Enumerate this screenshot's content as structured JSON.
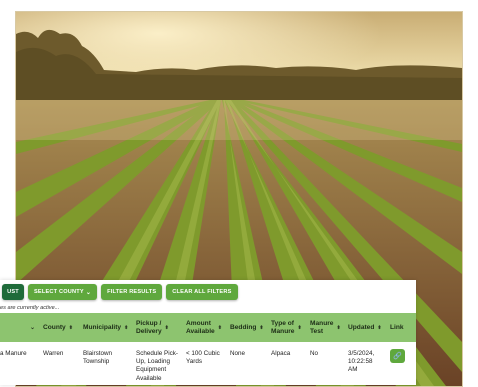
{
  "toolbar": {
    "list_label": "UST",
    "select_county_label": "SELECT COUNTY",
    "select_county_caret": "⌄",
    "filter_results_label": "FILTER RESULTS",
    "clear_filters_label": "CLEAR ALL FILTERS"
  },
  "status_text": "es are currently active...",
  "columns": {
    "county": "County",
    "municipality": "Municipality",
    "pickup_line1": "Pickup /",
    "pickup_line2": "Delivery",
    "amount_line1": "Amount",
    "amount_line2": "Available",
    "bedding": "Bedding",
    "type_line1": "Type of",
    "type_line2": "Manure",
    "test_line1": "Manure",
    "test_line2": "Test",
    "updated": "Updated",
    "link": "Link",
    "sort_glyph": "⬍",
    "first_col_caret": "⌄"
  },
  "row": {
    "name": "a Manure",
    "county": "Warren",
    "municipality_line1": "Blairstown",
    "municipality_line2": "Township",
    "pickup_line1": "Schedule Pick-",
    "pickup_line2": "Up, Loading",
    "pickup_line3": "Equipment",
    "pickup_line4": "Available",
    "amount_line1": "< 100 Cubic",
    "amount_line2": "Yards",
    "bedding": "None",
    "type": "Alpaca",
    "test": "No",
    "updated_line1": "3/5/2024,",
    "updated_line2": "10:22:58",
    "updated_line3": "AM",
    "link_icon": "🔗"
  },
  "colors": {
    "dark_green": "#1f6b3a",
    "light_green": "#5fa83d",
    "header_green": "#8dc46f"
  }
}
